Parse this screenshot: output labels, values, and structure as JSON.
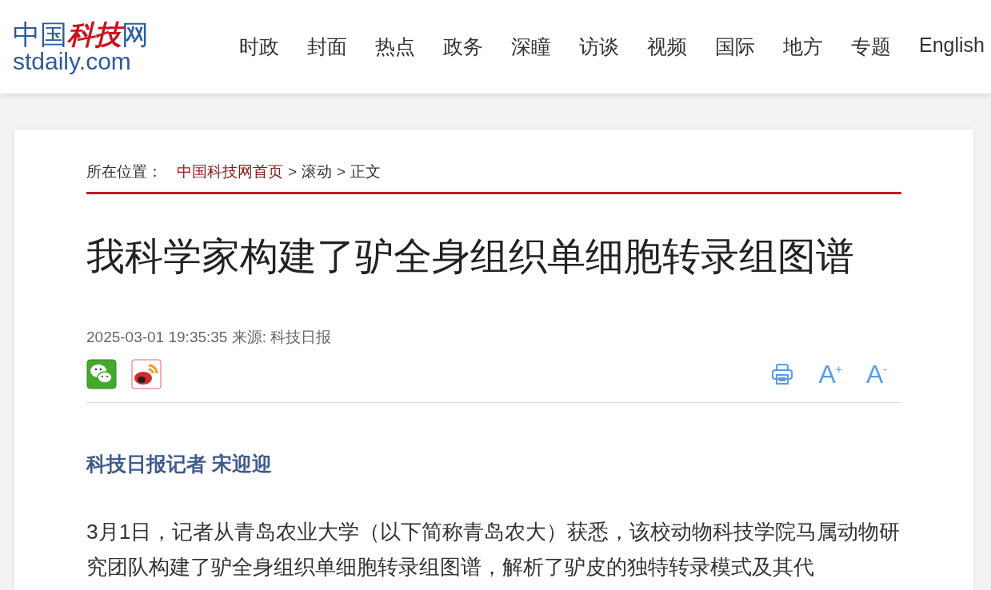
{
  "logo": {
    "prefix": "中国",
    "highlight": "科技",
    "suffix": "网",
    "domain": "stdaily.com"
  },
  "nav": [
    "时政",
    "封面",
    "热点",
    "政务",
    "深瞳",
    "访谈",
    "视频",
    "国际",
    "地方",
    "专题",
    "English"
  ],
  "breadcrumb": {
    "label": "所在位置：",
    "items": [
      {
        "text": "中国科技网首页",
        "kind": "link"
      },
      {
        "text": ">",
        "kind": "sep"
      },
      {
        "text": "滚动",
        "kind": "link"
      },
      {
        "text": ">",
        "kind": "sep"
      },
      {
        "text": "正文",
        "kind": "link"
      }
    ]
  },
  "article": {
    "title": "我科学家构建了驴全身组织单细胞转录组图谱",
    "meta": "2025-03-01 19:35:35 来源: 科技日报",
    "share": [
      {
        "kind": "wechat"
      },
      {
        "kind": "weibo"
      }
    ],
    "tools": [
      {
        "kind": "print"
      },
      {
        "kind": "font",
        "label": "A$^{+}$"
      },
      {
        "kind": "font",
        "label": "A$^{-}$"
      }
    ],
    "author": "科技日报记者 宋迎迎",
    "paragraphs": [
      "3月1日，记者从青岛农业大学（以下简称青岛农大）获悉，该校动物科技学院马属动物研究团队构建了驴全身组织单细胞转录组图谱，解析了驴皮的独特转录模式及其代"
    ]
  }
}
